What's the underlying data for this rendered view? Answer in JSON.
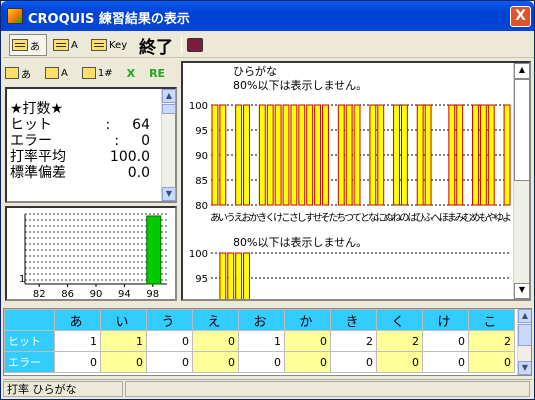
{
  "window": {
    "title": "CROQUIS 練習結果の表示",
    "close": "X"
  },
  "toolbar": {
    "hiragana": "あ",
    "alpha": "A",
    "key": "Key",
    "finish": "終了"
  },
  "lefttool": {
    "hiragana": "あ",
    "alpha": "A",
    "num": "1#",
    "x": "X",
    "re": "RE"
  },
  "stats": {
    "heading": "★打数★",
    "rows": [
      {
        "label": "ヒット",
        "sep": ":",
        "value": "64"
      },
      {
        "label": "エラー",
        "sep": ":",
        "value": "0"
      },
      {
        "label": "打率平均",
        "sep": ":",
        "value": "100.0"
      },
      {
        "label": "標準偏差",
        "sep": ":",
        "value": "0.0"
      }
    ]
  },
  "chart_data": [
    {
      "type": "bar",
      "title": "ひらがな",
      "subtitle": "80%以下は表示しません。",
      "ylim": [
        80,
        100
      ],
      "yticks": [
        80,
        85,
        90,
        95,
        100
      ],
      "categories": [
        "あ",
        "い",
        "う",
        "え",
        "お",
        "か",
        "き",
        "く",
        "け",
        "こ",
        "さ",
        "し",
        "す",
        "せ",
        "そ",
        "た",
        "ち",
        "つ",
        "て",
        "と",
        "な",
        "に",
        "ぬ",
        "ね",
        "の",
        "は",
        "ひ",
        "ふ",
        "へ",
        "ほ",
        "ま",
        "み",
        "む",
        "め",
        "も",
        "や",
        "ゆ",
        "よ"
      ],
      "values": [
        100,
        100,
        null,
        100,
        100,
        null,
        100,
        100,
        100,
        100,
        100,
        100,
        100,
        100,
        100,
        null,
        100,
        100,
        100,
        null,
        100,
        100,
        null,
        100,
        100,
        null,
        100,
        100,
        null,
        null,
        100,
        100,
        null,
        100,
        100,
        100,
        null,
        100
      ]
    },
    {
      "type": "bar",
      "subtitle": "80%以下は表示しません。",
      "ylim": [
        90,
        100
      ],
      "yticks": [
        95,
        100
      ],
      "values": [
        null,
        100,
        100,
        100,
        100
      ]
    },
    {
      "type": "histogram",
      "xticks": [
        82,
        86,
        90,
        94,
        98
      ],
      "ymin_label": "1",
      "bins": [
        {
          "x": 98,
          "count": 64
        }
      ]
    }
  ],
  "grid": {
    "columns": [
      "あ",
      "い",
      "う",
      "え",
      "お",
      "か",
      "き",
      "く",
      "け",
      "こ"
    ],
    "rows": [
      {
        "label": "ヒット",
        "values": [
          "1",
          "1",
          "0",
          "0",
          "1",
          "0",
          "2",
          "2",
          "0",
          "2"
        ]
      },
      {
        "label": "エラー",
        "values": [
          "0",
          "0",
          "0",
          "0",
          "0",
          "0",
          "0",
          "0",
          "0",
          "0"
        ]
      }
    ]
  },
  "status": {
    "text": "打率 ひらがな"
  }
}
